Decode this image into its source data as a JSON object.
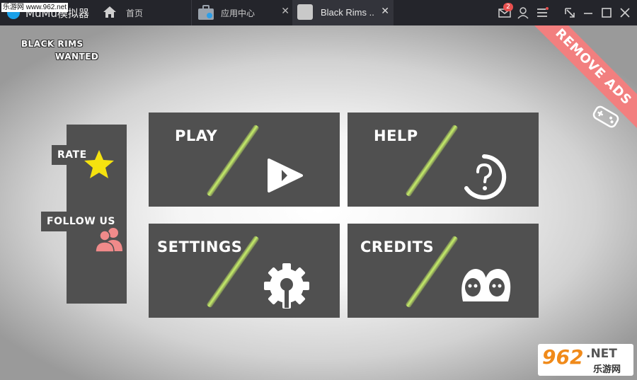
{
  "window": {
    "brand": "MuMu模拟器",
    "watermark_top": "乐游网 www.962.net",
    "tabs": [
      {
        "label": "首页"
      },
      {
        "label": "应用中心"
      },
      {
        "label": "Black Rims .."
      }
    ],
    "notification_count": "2"
  },
  "game": {
    "title_line1": "BLACK RIMS",
    "title_line2": "WANTED",
    "side": {
      "rate": "RATE",
      "follow": "FOLLOW US"
    },
    "tiles": {
      "play": "PLAY",
      "help": "HELP",
      "settings": "SETTINGS",
      "credits": "CREDITS"
    },
    "remove_ads": "REMOVE ADS",
    "colors": {
      "tile": "#505050",
      "slash": "#c8f06a",
      "star": "#f5e20f",
      "follow_icon": "#f08a8a",
      "ribbon": "#f27f7f"
    }
  },
  "watermark_bottom": {
    "number": "962",
    "domain": ".NET",
    "cn": "乐游网"
  }
}
